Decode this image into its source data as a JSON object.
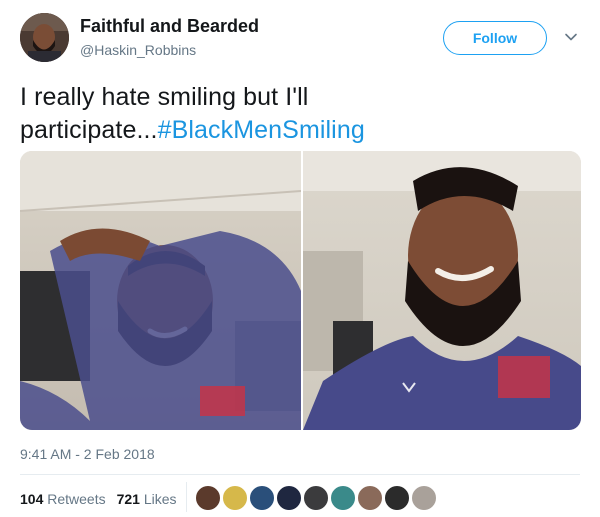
{
  "user": {
    "display_name": "Faithful and Bearded",
    "handle": "@Haskin_Robbins"
  },
  "follow_label": "Follow",
  "tweet": {
    "text_plain": "I really hate smiling but I'll participate...",
    "hashtag": "#BlackMenSmiling"
  },
  "timestamp": "9:41 AM - 2 Feb 2018",
  "stats": {
    "retweets_count": "104",
    "retweets_label": "Retweets",
    "likes_count": "721",
    "likes_label": "Likes"
  },
  "likers": [
    "liker-1",
    "liker-2",
    "liker-3",
    "liker-4",
    "liker-5",
    "liker-6",
    "liker-7",
    "liker-8",
    "liker-9"
  ],
  "colors": {
    "accent": "#1da1f2",
    "hashtag": "#1b95e0",
    "muted": "#657786",
    "text": "#14171a"
  }
}
